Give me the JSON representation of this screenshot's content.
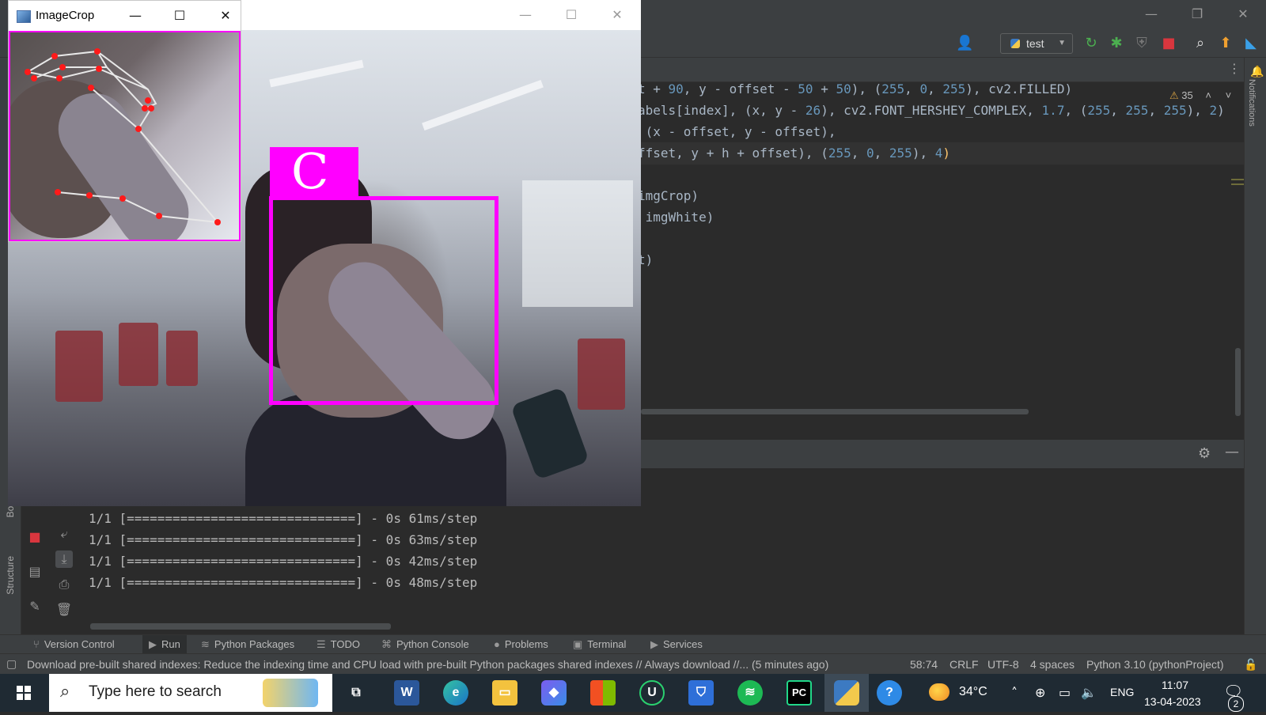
{
  "ide": {
    "run_config": "test",
    "warnings": "35",
    "code_lines": [
      {
        "parts": [
          [
            "c-const",
            "t + "
          ],
          [
            "c-num",
            "90"
          ],
          [
            "c-const",
            ", y - offset - "
          ],
          [
            "c-num",
            "50"
          ],
          [
            "c-const",
            " + "
          ],
          [
            "c-num",
            "50"
          ],
          [
            "c-const",
            "), ("
          ],
          [
            "c-num",
            "255"
          ],
          [
            "c-const",
            ", "
          ],
          [
            "c-num",
            "0"
          ],
          [
            "c-const",
            ", "
          ],
          [
            "c-num",
            "255"
          ],
          [
            "c-const",
            "), cv2.FILLED)"
          ]
        ]
      },
      {
        "parts": [
          [
            "c-const",
            "abels[index], (x, y - "
          ],
          [
            "c-num",
            "26"
          ],
          [
            "c-const",
            "), cv2.FONT_HERSHEY_COMPLEX, "
          ],
          [
            "c-num",
            "1.7"
          ],
          [
            "c-const",
            ", ("
          ],
          [
            "c-num",
            "255"
          ],
          [
            "c-const",
            ", "
          ],
          [
            "c-num",
            "255"
          ],
          [
            "c-const",
            ", "
          ],
          [
            "c-num",
            "255"
          ],
          [
            "c-const",
            "), "
          ],
          [
            "c-num",
            "2"
          ],
          [
            "c-const",
            ")"
          ]
        ]
      },
      {
        "parts": [
          [
            "c-const",
            " (x - offset, y - offset),"
          ]
        ]
      },
      {
        "parts": [
          [
            "c-const",
            "ffset, y + h + offset), ("
          ],
          [
            "c-num",
            "255"
          ],
          [
            "c-const",
            ", "
          ],
          [
            "c-num",
            "0"
          ],
          [
            "c-const",
            ", "
          ],
          [
            "c-num",
            "255"
          ],
          [
            "c-const",
            "), "
          ],
          [
            "c-num",
            "4"
          ],
          [
            "c-hl",
            ")"
          ]
        ]
      },
      {
        "parts": []
      },
      {
        "parts": [
          [
            "c-const",
            "imgCrop)"
          ]
        ]
      },
      {
        "parts": [
          [
            "c-const",
            " imgWhite)"
          ]
        ]
      },
      {
        "parts": []
      },
      {
        "parts": [
          [
            "c-const",
            "t)"
          ]
        ]
      }
    ],
    "console_lines": [
      "1/1 [==============================] - 0s 61ms/step",
      "1/1 [==============================] - 0s 63ms/step",
      "1/1 [==============================] - 0s 42ms/step",
      "1/1 [==============================] - 0s 48ms/step"
    ],
    "left_labels": {
      "bookmarks": "Boo",
      "structure": "Structure"
    },
    "notifications_label": "Notifications",
    "bottom_tabs": [
      {
        "label": "Version Control",
        "icon": "branch-icon",
        "glyph": "⑂"
      },
      {
        "label": "Run",
        "icon": "run-icon",
        "glyph": "▶"
      },
      {
        "label": "Python Packages",
        "icon": "layers-icon",
        "glyph": "≋"
      },
      {
        "label": "TODO",
        "icon": "list-icon",
        "glyph": "☰"
      },
      {
        "label": "Python Console",
        "icon": "python-icon",
        "glyph": "⌘"
      },
      {
        "label": "Problems",
        "icon": "info-icon",
        "glyph": "●"
      },
      {
        "label": "Terminal",
        "icon": "terminal-icon",
        "glyph": "▣"
      },
      {
        "label": "Services",
        "icon": "services-icon",
        "glyph": "▶"
      }
    ],
    "status": {
      "message": "Download pre-built shared indexes: Reduce the indexing time and CPU load with pre-built Python packages shared indexes // Always download //... (5 minutes ago)",
      "position": "58:74",
      "line_ending": "CRLF",
      "encoding": "UTF-8",
      "indent": "4 spaces",
      "interpreter": "Python 3.10 (pythonProject)"
    }
  },
  "crop_window": {
    "title": "ImageCrop"
  },
  "cam_window": {
    "prediction_label": "C"
  },
  "taskbar": {
    "search_placeholder": "Type here to search",
    "temperature": "34°C",
    "language": "ENG",
    "time": "11:07",
    "date": "13-04-2023",
    "notification_count": "2"
  },
  "colors": {
    "accent": "#ff00ff",
    "ide_bg": "#2b2b2b",
    "ide_panel": "#3c3f41",
    "taskbar": "#1f2a33"
  }
}
